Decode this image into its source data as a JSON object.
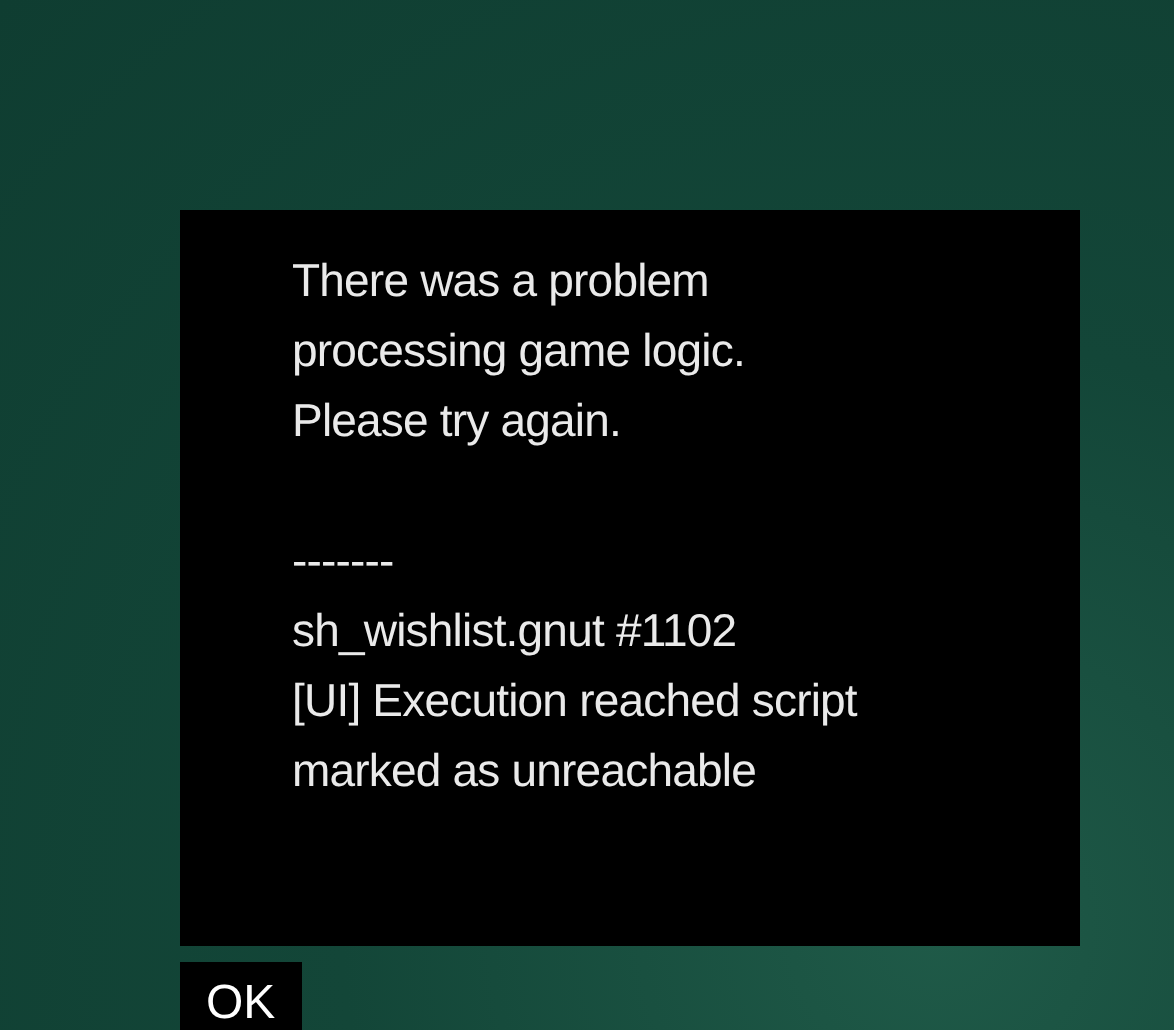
{
  "dialog": {
    "paragraphs": [
      "There was a problem\nprocessing game logic.\nPlease try again.",
      "-------\nsh_wishlist.gnut #1102\n[UI] Execution reached script\nmarked as unreachable"
    ]
  },
  "buttons": [
    "OK"
  ]
}
